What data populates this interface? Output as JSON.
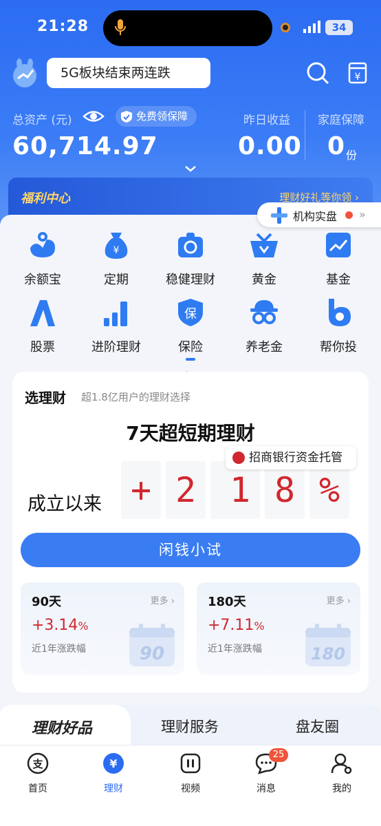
{
  "status_bar": {
    "time": "21:28",
    "battery": "34"
  },
  "header": {
    "search_hint": "5G板块结束两连跌"
  },
  "assets": {
    "total_label": "总资产 (元)",
    "total_value": "60,714.97",
    "insurance_badge": "免费领保障",
    "yesterday_label": "昨日收益",
    "yesterday_value": "0.00",
    "family_label": "家庭保障",
    "family_value": "0",
    "family_unit": "份"
  },
  "welfare": {
    "title": "福利中心",
    "right": "理财好礼等你领 ›"
  },
  "floating": {
    "label": "机构实盘",
    "arrow": "»"
  },
  "grid": [
    {
      "label": "余额宝",
      "icon": "yuebao-icon"
    },
    {
      "label": "定期",
      "icon": "money-bag-icon"
    },
    {
      "label": "稳健理财",
      "icon": "safe-lock-icon"
    },
    {
      "label": "黄金",
      "icon": "gold-basket-icon"
    },
    {
      "label": "基金",
      "icon": "fund-chart-icon"
    },
    {
      "label": "股票",
      "icon": "stock-a-icon"
    },
    {
      "label": "进阶理财",
      "icon": "bar-chart-icon"
    },
    {
      "label": "保险",
      "icon": "insurance-shield-icon"
    },
    {
      "label": "养老金",
      "icon": "pension-icon"
    },
    {
      "label": "帮你投",
      "icon": "helper-b-icon"
    }
  ],
  "select": {
    "title": "选理财",
    "subtitle": "超1.8亿用户的理财选择",
    "product": "7天超短期理财",
    "bank": "招商银行资金托管",
    "since_label": "成立以来",
    "digits": [
      "+",
      "2",
      ".",
      "1",
      "8",
      "%"
    ],
    "cta": "闲钱小试",
    "cards": [
      {
        "days": "90天",
        "more": "更多 ›",
        "rate": "+3.14",
        "unit": "%",
        "note": "近1年涨跌幅",
        "cal": "90"
      },
      {
        "days": "180天",
        "more": "更多 ›",
        "rate": "+7.11",
        "unit": "%",
        "note": "近1年涨跌幅",
        "cal": "180"
      }
    ]
  },
  "tabs": [
    "理财好品",
    "理财服务",
    "盘友圈"
  ],
  "bottom_nav": [
    {
      "label": "首页",
      "icon": "alipay-icon"
    },
    {
      "label": "理财",
      "icon": "wealth-icon"
    },
    {
      "label": "视频",
      "icon": "video-icon"
    },
    {
      "label": "消息",
      "icon": "message-icon",
      "badge": "25"
    },
    {
      "label": "我的",
      "icon": "profile-icon"
    }
  ],
  "colors": {
    "brand": "#2b6cf2",
    "red": "#d0282e",
    "gold": "#ffd56a"
  }
}
